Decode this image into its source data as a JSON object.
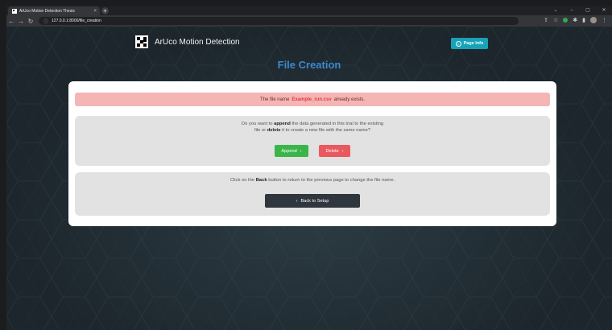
{
  "browser": {
    "tab_title": "ArUco Motion Detection Thesis",
    "tab_close": "×",
    "new_tab": "+",
    "url": "127.0.0.1:8000/file_creation"
  },
  "header": {
    "brand_name": "ArUco Motion Detection",
    "page_info_label": "Page Info"
  },
  "page": {
    "title": "File Creation"
  },
  "alert": {
    "prefix": "The file name",
    "filename": "Example_run.csv",
    "suffix": "already exists."
  },
  "append_panel": {
    "line1_a": "Do you want to",
    "line1_b": "append",
    "line1_c": "the data generated in this trial to the existing",
    "line2_a": "file or",
    "line2_b": "delete",
    "line2_c": "it to create a new file with the same name?",
    "append_label": "Append",
    "delete_label": "Delete"
  },
  "back_panel": {
    "text_a": "Click on the",
    "text_b": "Back",
    "text_c": "button to return to the previous page to change the file name.",
    "back_label": "Back to Setup"
  },
  "colors": {
    "title": "#3d88cf",
    "alert_bg": "#f5b5b5",
    "append": "#3bb54a",
    "delete": "#e85a5f",
    "page_info": "#17a2b8"
  }
}
